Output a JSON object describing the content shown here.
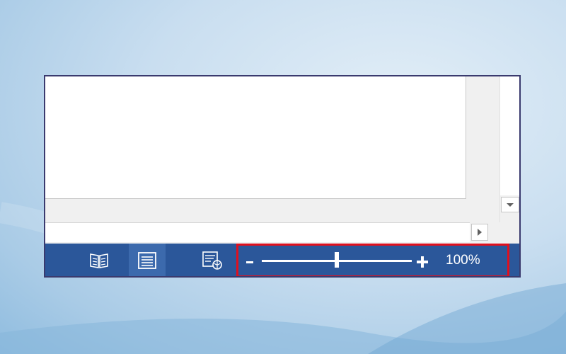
{
  "status_bar": {
    "view_buttons": [
      {
        "icon": "read-mode-icon",
        "active": false
      },
      {
        "icon": "print-layout-icon",
        "active": true
      },
      {
        "icon": "web-layout-icon",
        "active": false
      }
    ],
    "zoom": {
      "level_text": "100%",
      "slider_fraction": 0.5,
      "minus_icon": "zoom-out-icon",
      "plus_icon": "zoom-in-icon",
      "highlight_color": "#e0101e"
    },
    "background_color": "#2b579a"
  },
  "scrollbars": {
    "vertical_down_icon": "scroll-down-arrow-icon",
    "horizontal_right_icon": "scroll-right-arrow-icon"
  }
}
